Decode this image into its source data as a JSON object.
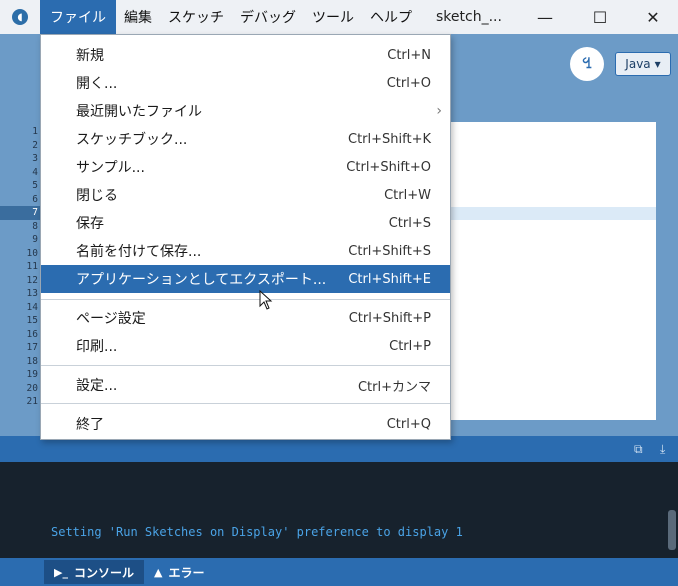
{
  "menubar": {
    "items": [
      "ファイル",
      "編集",
      "スケッチ",
      "デバッグ",
      "ツール",
      "ヘルプ"
    ],
    "window_title": "sketch_..."
  },
  "toolbar": {
    "debug_label": "",
    "mode_label": "Java"
  },
  "editor": {
    "line_numbers": [
      "1",
      "2",
      "3",
      "4",
      "5",
      "6",
      "7",
      "8",
      "9",
      "10",
      "11",
      "12",
      "13",
      "14",
      "15",
      "16",
      "17",
      "18",
      "19",
      "20",
      "21"
    ]
  },
  "file_menu": {
    "items": [
      {
        "label": "新規",
        "shortcut": "Ctrl+N"
      },
      {
        "label": "開く...",
        "shortcut": "Ctrl+O"
      },
      {
        "label": "最近開いたファイル",
        "shortcut": ""
      },
      {
        "label": "スケッチブック...",
        "shortcut": "Ctrl+Shift+K"
      },
      {
        "label": "サンプル...",
        "shortcut": "Ctrl+Shift+O"
      },
      {
        "label": "閉じる",
        "shortcut": "Ctrl+W"
      },
      {
        "label": "保存",
        "shortcut": "Ctrl+S"
      },
      {
        "label": "名前を付けて保存...",
        "shortcut": "Ctrl+Shift+S"
      },
      {
        "label": "アプリケーションとしてエクスポート...",
        "shortcut": "Ctrl+Shift+E"
      },
      {
        "label": "ページ設定",
        "shortcut": "Ctrl+Shift+P"
      },
      {
        "label": "印刷...",
        "shortcut": "Ctrl+P"
      },
      {
        "label": "設定...",
        "shortcut": "Ctrl+カンマ"
      },
      {
        "label": "終了",
        "shortcut": "Ctrl+Q"
      }
    ]
  },
  "console": {
    "message": "Setting 'Run Sketches on Display' preference to display 1"
  },
  "statusbar": {
    "tabs": [
      "コンソール",
      "エラー"
    ]
  },
  "colors": {
    "accent": "#2b6cb0",
    "background": "#6c9bc7",
    "console_bg": "#17222d",
    "console_text": "#4aa3e6"
  }
}
